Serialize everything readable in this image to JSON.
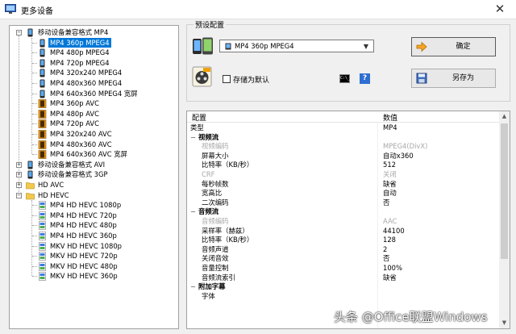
{
  "window": {
    "title": "更多设备",
    "close_glyph": "✕"
  },
  "tree": {
    "items": [
      {
        "label": "移动设备兼容格式 MP4",
        "level": 0,
        "expander": "−",
        "icon": "phone-icon",
        "selected": false
      },
      {
        "label": "MP4 360p MPEG4",
        "level": 1,
        "icon": "phone-icon",
        "selected": true
      },
      {
        "label": "MP4 480p MPEG4",
        "level": 1,
        "icon": "phone-icon",
        "selected": false
      },
      {
        "label": "MP4 720p MPEG4",
        "level": 1,
        "icon": "phone-icon",
        "selected": false
      },
      {
        "label": "MP4 320x240 MPEG4",
        "level": 1,
        "icon": "phone-icon",
        "selected": false
      },
      {
        "label": "MP4 480x360 MPEG4",
        "level": 1,
        "icon": "phone-icon",
        "selected": false
      },
      {
        "label": "MP4 640x360 MPEG4 宽屏",
        "level": 1,
        "icon": "phone-icon",
        "selected": false
      },
      {
        "label": "MP4 360p AVC",
        "level": 1,
        "icon": "film-strip-icon",
        "selected": false
      },
      {
        "label": "MP4 480p AVC",
        "level": 1,
        "icon": "film-strip-icon",
        "selected": false
      },
      {
        "label": "MP4 720p AVC",
        "level": 1,
        "icon": "film-strip-icon",
        "selected": false
      },
      {
        "label": "MP4 320x240 AVC",
        "level": 1,
        "icon": "film-strip-icon",
        "selected": false
      },
      {
        "label": "MP4 480x360 AVC",
        "level": 1,
        "icon": "film-strip-icon",
        "selected": false
      },
      {
        "label": "MP4 640x360 AVC 宽屏",
        "level": 1,
        "icon": "film-strip-icon",
        "selected": false
      },
      {
        "label": "移动设备兼容格式 AVI",
        "level": 0,
        "expander": "+",
        "icon": "phone-icon",
        "selected": false
      },
      {
        "label": "移动设备兼容格式 3GP",
        "level": 0,
        "expander": "+",
        "icon": "phone-icon",
        "selected": false
      },
      {
        "label": "HD AVC",
        "level": 0,
        "expander": "+",
        "icon": "folder-icon",
        "selected": false
      },
      {
        "label": "HD HEVC",
        "level": 0,
        "expander": "−",
        "icon": "folder-icon",
        "selected": false
      },
      {
        "label": "MP4 HD HEVC 1080p",
        "level": 1,
        "icon": "hevc-file-icon",
        "selected": false
      },
      {
        "label": "MP4 HD HEVC 720p",
        "level": 1,
        "icon": "hevc-file-icon",
        "selected": false
      },
      {
        "label": "MP4 HD HEVC 480p",
        "level": 1,
        "icon": "hevc-file-icon",
        "selected": false
      },
      {
        "label": "MP4 HD HEVC 360p",
        "level": 1,
        "icon": "hevc-file-icon",
        "selected": false
      },
      {
        "label": "MKV HD HEVC 1080p",
        "level": 1,
        "icon": "hevc-file-icon",
        "selected": false
      },
      {
        "label": "MKV HD HEVC 720p",
        "level": 1,
        "icon": "hevc-file-icon",
        "selected": false
      },
      {
        "label": "MKV HD HEVC 480p",
        "level": 1,
        "icon": "hevc-file-icon",
        "selected": false
      },
      {
        "label": "MKV HD HEVC 360p",
        "level": 1,
        "icon": "hevc-file-icon",
        "selected": false
      }
    ]
  },
  "preset": {
    "group_title": "预设配置",
    "dropdown_value": "MP4 360p MPEG4",
    "save_default_label": "存储为默认",
    "save_default_checked": false,
    "ok_label": "确定",
    "save_as_label": "另存为",
    "help_glyph": "?",
    "cmd_glyph": "C:\\_"
  },
  "properties": {
    "header_key": "配置",
    "header_value": "数值",
    "rows": [
      {
        "key": "类型",
        "value": "MP4",
        "kind": "top"
      },
      {
        "key": "视频流",
        "kind": "cat"
      },
      {
        "key": "视频编码",
        "value": "MPEG4(DivX)",
        "kind": "prop",
        "disabled": true
      },
      {
        "key": "屏幕大小",
        "value": "自动x360",
        "kind": "prop"
      },
      {
        "key": "比特率（KB/秒）",
        "value": "512",
        "kind": "prop"
      },
      {
        "key": "CRF",
        "value": "关闭",
        "kind": "prop",
        "disabled": true
      },
      {
        "key": "每秒帧数",
        "value": "缺省",
        "kind": "prop"
      },
      {
        "key": "宽高比",
        "value": "自动",
        "kind": "prop"
      },
      {
        "key": "二次编码",
        "value": "否",
        "kind": "prop"
      },
      {
        "key": "音频流",
        "kind": "cat"
      },
      {
        "key": "音频编码",
        "value": "AAC",
        "kind": "prop",
        "disabled": true
      },
      {
        "key": "采样率（赫兹）",
        "value": "44100",
        "kind": "prop"
      },
      {
        "key": "比特率（KB/秒）",
        "value": "128",
        "kind": "prop"
      },
      {
        "key": "音频声道",
        "value": "2",
        "kind": "prop"
      },
      {
        "key": "关闭音效",
        "value": "否",
        "kind": "prop"
      },
      {
        "key": "音量控制",
        "value": "100%",
        "kind": "prop"
      },
      {
        "key": "音频流索引",
        "value": "缺省",
        "kind": "prop"
      },
      {
        "key": "附加字幕",
        "kind": "cat"
      },
      {
        "key": "字体",
        "value": "",
        "kind": "prop"
      }
    ]
  },
  "watermark": "头条 @Office联盟Windows"
}
